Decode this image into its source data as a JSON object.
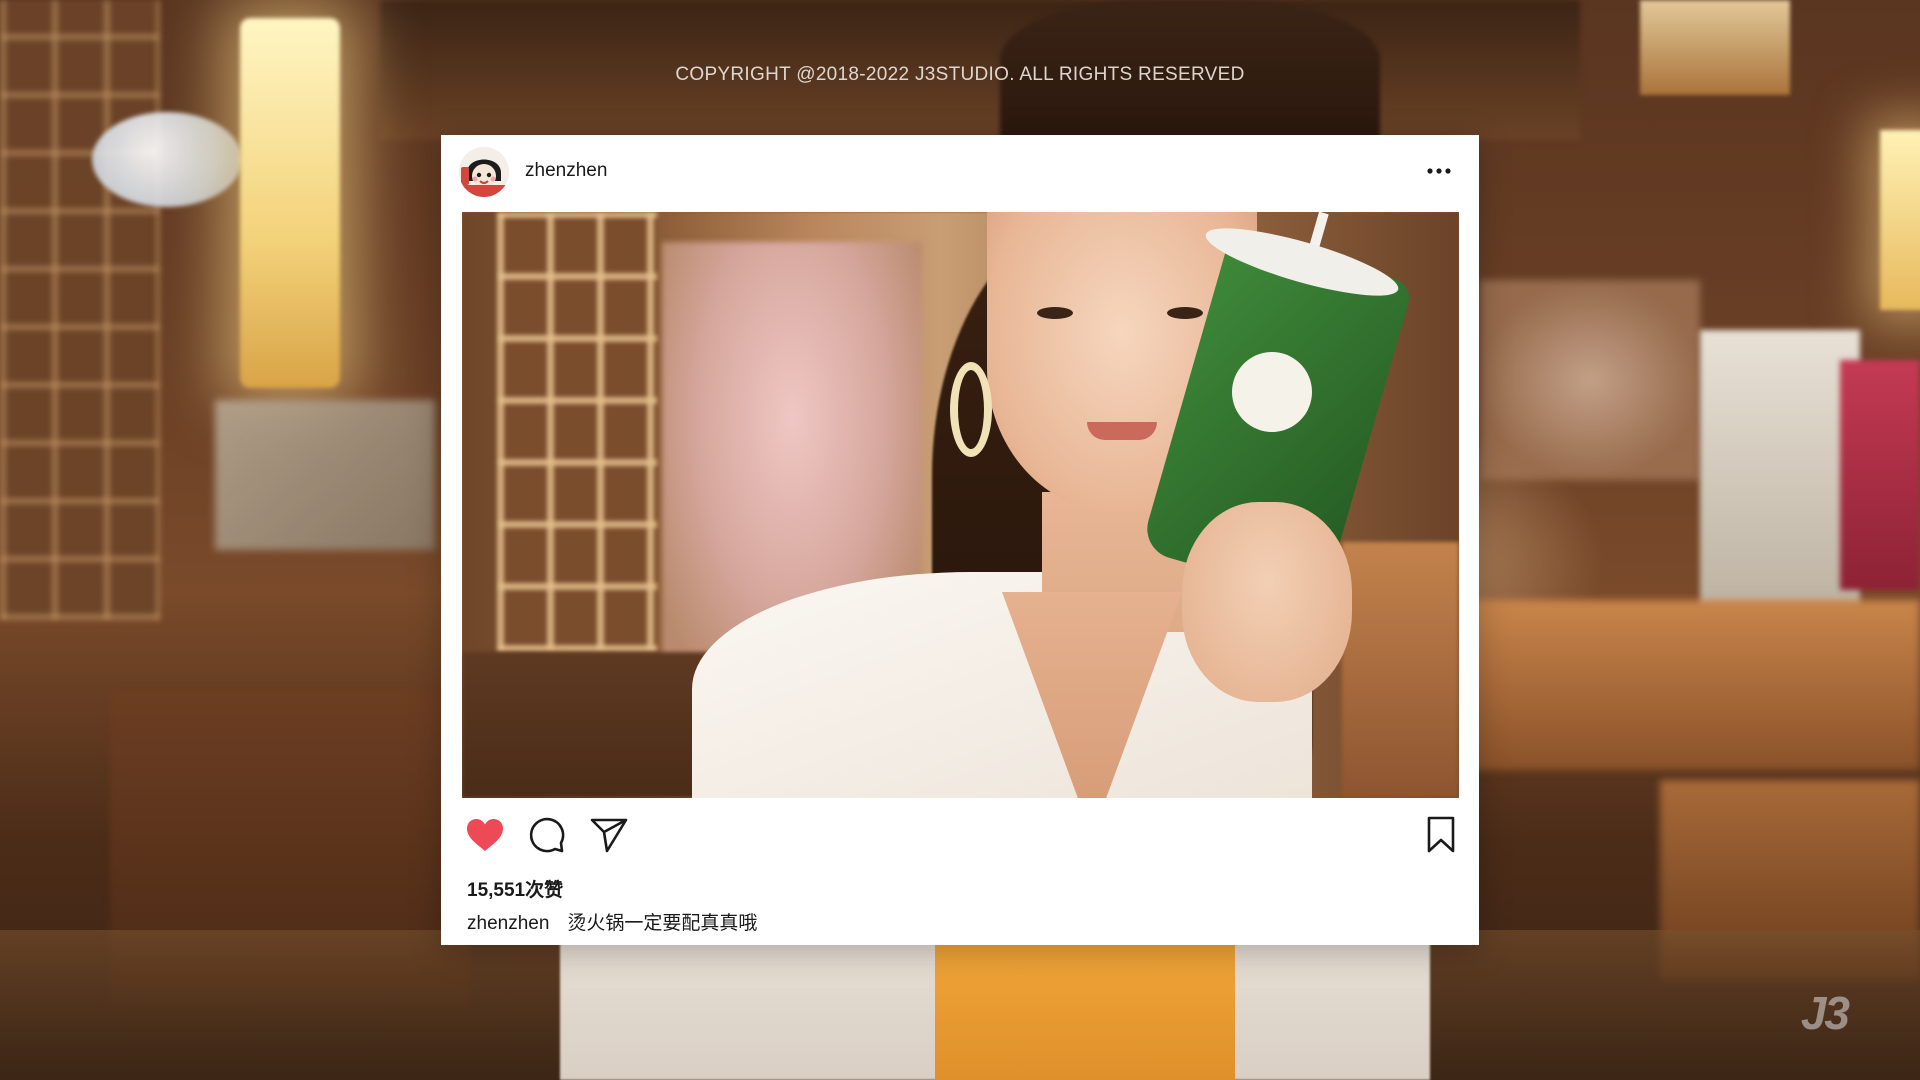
{
  "overlay": {
    "copyright": "COPYRIGHT @2018-2022 J3STUDIO. ALL RIGHTS RESERVED",
    "watermark": "J3"
  },
  "post": {
    "username": "zhenzhen",
    "more_icon": "more-horizontal-icon",
    "avatar_icon": "cartoon-avatar",
    "actions": {
      "like_icon": "heart-icon",
      "liked": true,
      "like_color": "#ed4956",
      "comment_icon": "comment-icon",
      "share_icon": "send-icon",
      "save_icon": "bookmark-icon"
    },
    "likes_text": "15,551次赞",
    "caption": {
      "username": "zhenzhen",
      "text": "烫火锅一定要配真真哦"
    }
  }
}
